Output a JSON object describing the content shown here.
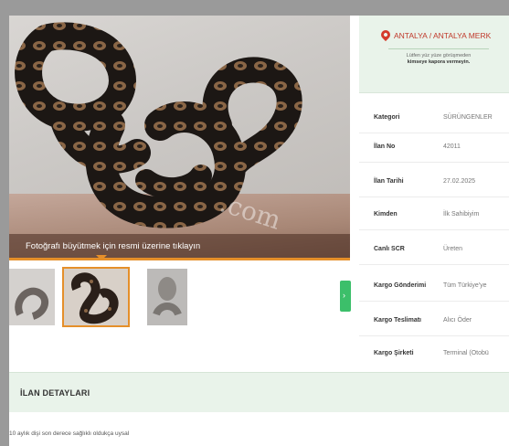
{
  "gallery": {
    "watermark": ".com",
    "enlarge_label": "Fotoğrafı büyütmek için resmi üzerine tıklayın",
    "thumbnails": [
      "photo-1",
      "photo-2",
      "photo-3"
    ],
    "next_icon": "chevron-right-icon",
    "accent_color": "#e58f2a"
  },
  "location": {
    "icon": "map-pin-icon",
    "text": "ANTALYA / ANTALYA MERK",
    "note_line1": "Lütfen yüz yüze görüşmeden",
    "note_line2": "kimseye kapora vermeyin."
  },
  "info_rows": [
    {
      "key": "Kategori",
      "value": "SÜRÜNGENLER"
    },
    {
      "key": "İlan No",
      "value": "42011"
    },
    {
      "key": "İlan Tarihi",
      "value": "27.02.2025"
    },
    {
      "key": "Kimden",
      "value": "İlk Sahibiyim"
    },
    {
      "key": "Canlı SCR",
      "value": "Üreten"
    },
    {
      "key": "Kargo Gönderimi",
      "value": "Tüm Türkiye'ye"
    },
    {
      "key": "Kargo Teslimatı",
      "value": "Alıcı Öder"
    },
    {
      "key": "Kargo Şirketi",
      "value": "Terminal (Otobü"
    }
  ],
  "details": {
    "title": "İLAN DETAYLARI",
    "text": "10 aylık dişi son derece sağlıklı oldukça uysal"
  },
  "colors": {
    "panel_green": "#e9f3ea",
    "next_button": "#3cbf6a",
    "pin_red": "#d43b2c"
  }
}
